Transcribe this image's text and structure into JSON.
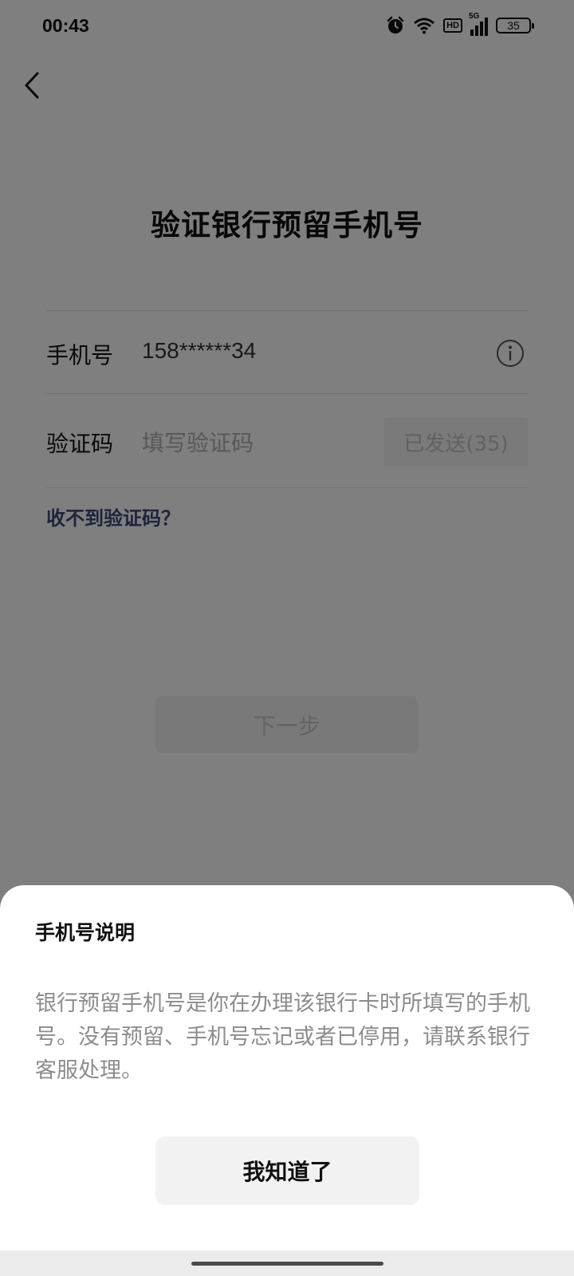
{
  "status_bar": {
    "time": "00:43",
    "hd_label": "HD",
    "network_label": "5G",
    "battery": "35"
  },
  "page": {
    "title": "验证银行预留手机号",
    "phone_row": {
      "label": "手机号",
      "value": "158******34"
    },
    "code_row": {
      "label": "验证码",
      "placeholder": "填写验证码",
      "send_button": "已发送(35)"
    },
    "help_link": "收不到验证码？",
    "next_button": "下一步"
  },
  "sheet": {
    "title": "手机号说明",
    "body": "银行预留手机号是你在办理该银行卡时所填写的手机号。没有预留、手机号忘记或者已停用，请联系银行客服处理。",
    "ok_button": "我知道了"
  },
  "colors": {
    "overlay": "#000000",
    "link": "#3b4a78",
    "muted_text": "#8c8c8c"
  }
}
